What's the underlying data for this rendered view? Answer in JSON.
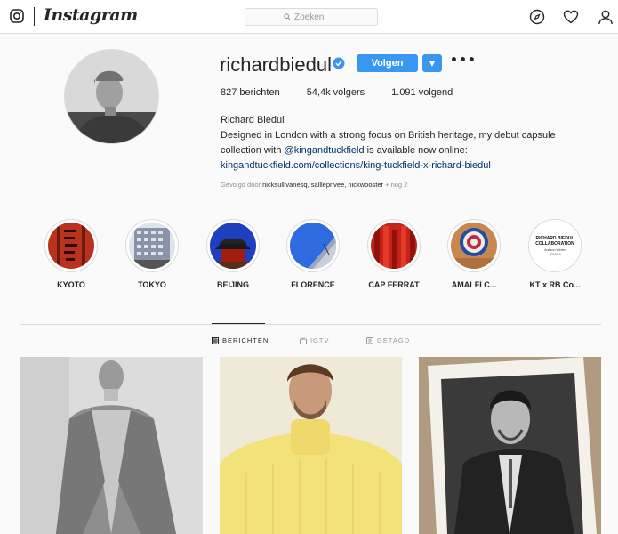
{
  "nav": {
    "wordmark": "Instagram",
    "search_placeholder": "Zoeken",
    "icons": [
      "instagram-icon",
      "search-icon",
      "compass-icon",
      "heart-icon",
      "profile-icon"
    ]
  },
  "profile": {
    "username": "richardbiedul",
    "verified": true,
    "follow_label": "Volgen",
    "dropdown_glyph": "▼",
    "more_glyph": "•••",
    "stats": {
      "posts": "827",
      "posts_label": "berichten",
      "followers": "54,4k",
      "followers_label": "volgers",
      "following": "1.091",
      "following_label": "volgend"
    },
    "full_name": "Richard Biedul",
    "bio_line1": "Designed in London with a strong focus on British heritage, my debut capsule",
    "bio_line2_prefix": "collection with ",
    "bio_mention": "@kingandtuckfield",
    "bio_line2_suffix": " is available now online:",
    "bio_link": "kingandtuckfield.com/collections/king-tuckfield-x-richard-biedul",
    "followed_by_prefix": "Gevolgd door ",
    "followed_by_names": "nicksullivanesq, sallleprivee, nickwooster",
    "followed_by_suffix": " + nog 2"
  },
  "highlights": [
    {
      "label": "KYOTO"
    },
    {
      "label": "TOKYO"
    },
    {
      "label": "BEIJING"
    },
    {
      "label": "FLORENCE"
    },
    {
      "label": "CAP FERRAT"
    },
    {
      "label": "AMALFI C..."
    },
    {
      "label": "KT x RB Co...",
      "cover_text_1": "RICHARD BIEDUL",
      "cover_text_2": "COLLABORATION",
      "cover_text_3": "Autumn Winter",
      "cover_text_4": "2018/19"
    }
  ],
  "tabs": [
    {
      "label": "BERICHTEN",
      "active": true,
      "icon": "grid-icon"
    },
    {
      "label": "IGTV",
      "active": false,
      "icon": "tv-icon"
    },
    {
      "label": "GETAGD",
      "active": false,
      "icon": "tag-icon"
    }
  ],
  "colors": {
    "accent": "#3897f0",
    "link": "#003569",
    "verified": "#3897f0"
  }
}
